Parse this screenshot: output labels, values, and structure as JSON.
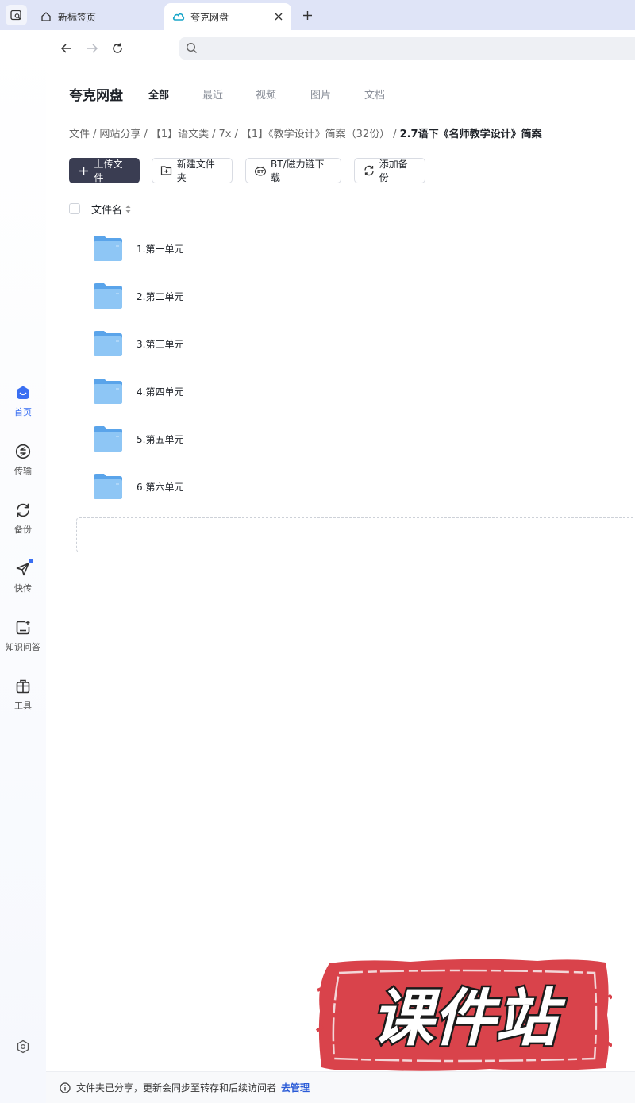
{
  "browser": {
    "tabs": [
      {
        "label": "新标签页",
        "active": false
      },
      {
        "label": "夸克网盘",
        "active": true
      }
    ],
    "address": {
      "value": "",
      "placeholder": ""
    }
  },
  "sidebar": {
    "items": [
      {
        "label": "首页",
        "icon": "home-face-icon",
        "active": true
      },
      {
        "label": "传输",
        "icon": "transfer-icon",
        "active": false
      },
      {
        "label": "备份",
        "icon": "backup-icon",
        "active": false
      },
      {
        "label": "快传",
        "icon": "send-icon",
        "active": false
      },
      {
        "label": "知识问答",
        "icon": "knowledge-qa-icon",
        "active": false
      },
      {
        "label": "工具",
        "icon": "toolbox-icon",
        "active": false
      }
    ]
  },
  "header": {
    "brand": "夸克网盘",
    "categories": [
      "全部",
      "最近",
      "视频",
      "图片",
      "文档"
    ],
    "active_category": "全部"
  },
  "breadcrumb": [
    "文件",
    "网站分享",
    "【1】语文类",
    "7x",
    "【1】《教学设计》简案（32份）",
    "2.7语下《名师教学设计》简案"
  ],
  "toolbar": {
    "upload": "上传文件",
    "new_folder": "新建文件夹",
    "bt_download": "BT/磁力链下载",
    "add_backup": "添加备份"
  },
  "list": {
    "header": "文件名",
    "rows": [
      "1.第一单元",
      "2.第二单元",
      "3.第三单元",
      "4.第四单元",
      "5.第五单元",
      "6.第六单元"
    ]
  },
  "watermark": {
    "text": "课件站"
  },
  "footer": {
    "notice": "文件夹已分享，更新会同步至转存和后续访问者",
    "link": "去管理"
  },
  "colors": {
    "accent": "#3a6ff2",
    "primary_button": "#3a3d52",
    "tabbar": "#dfe4f7",
    "stamp_red": "#d9434b"
  }
}
